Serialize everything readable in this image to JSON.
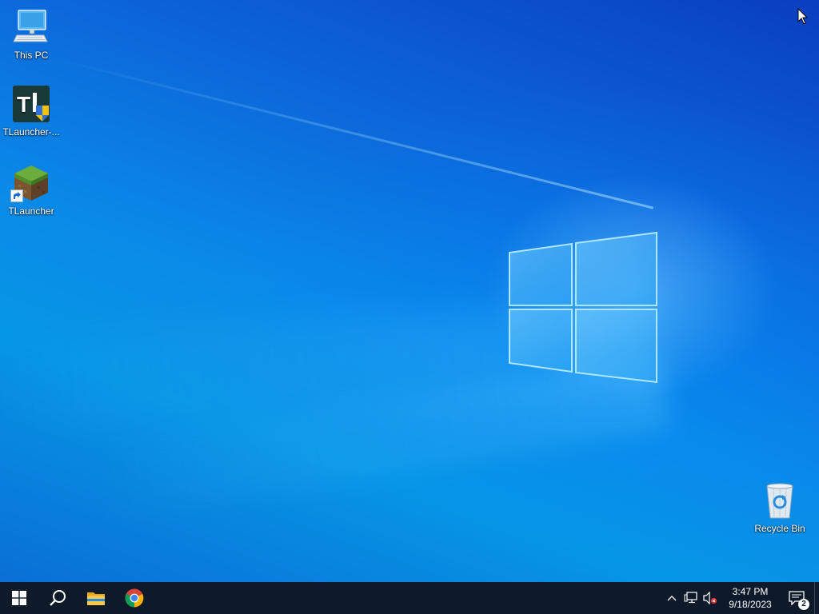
{
  "desktop": {
    "icons": [
      {
        "label": "This PC",
        "icon": "computer-icon"
      },
      {
        "label": "TLauncher-...",
        "icon": "tlauncher-installer-icon"
      },
      {
        "label": "TLauncher",
        "icon": "minecraft-grass-block-icon"
      },
      {
        "label": "Recycle Bin",
        "icon": "recycle-bin-icon"
      }
    ]
  },
  "taskbar": {
    "pinned": [
      {
        "name": "Start",
        "icon": "windows-logo-icon"
      },
      {
        "name": "Search",
        "icon": "search-icon"
      },
      {
        "name": "File Explorer",
        "icon": "folder-icon"
      },
      {
        "name": "Google Chrome",
        "icon": "chrome-icon"
      }
    ],
    "tray": {
      "icons": [
        "chevron-up-icon",
        "network-icon",
        "volume-muted-icon"
      ],
      "time": "3:47 PM",
      "date": "9/18/2023",
      "notification_count": "2"
    }
  },
  "colors": {
    "taskbar_bg": "#0e1a2a",
    "desktop_accent": "#0a8ae8"
  }
}
